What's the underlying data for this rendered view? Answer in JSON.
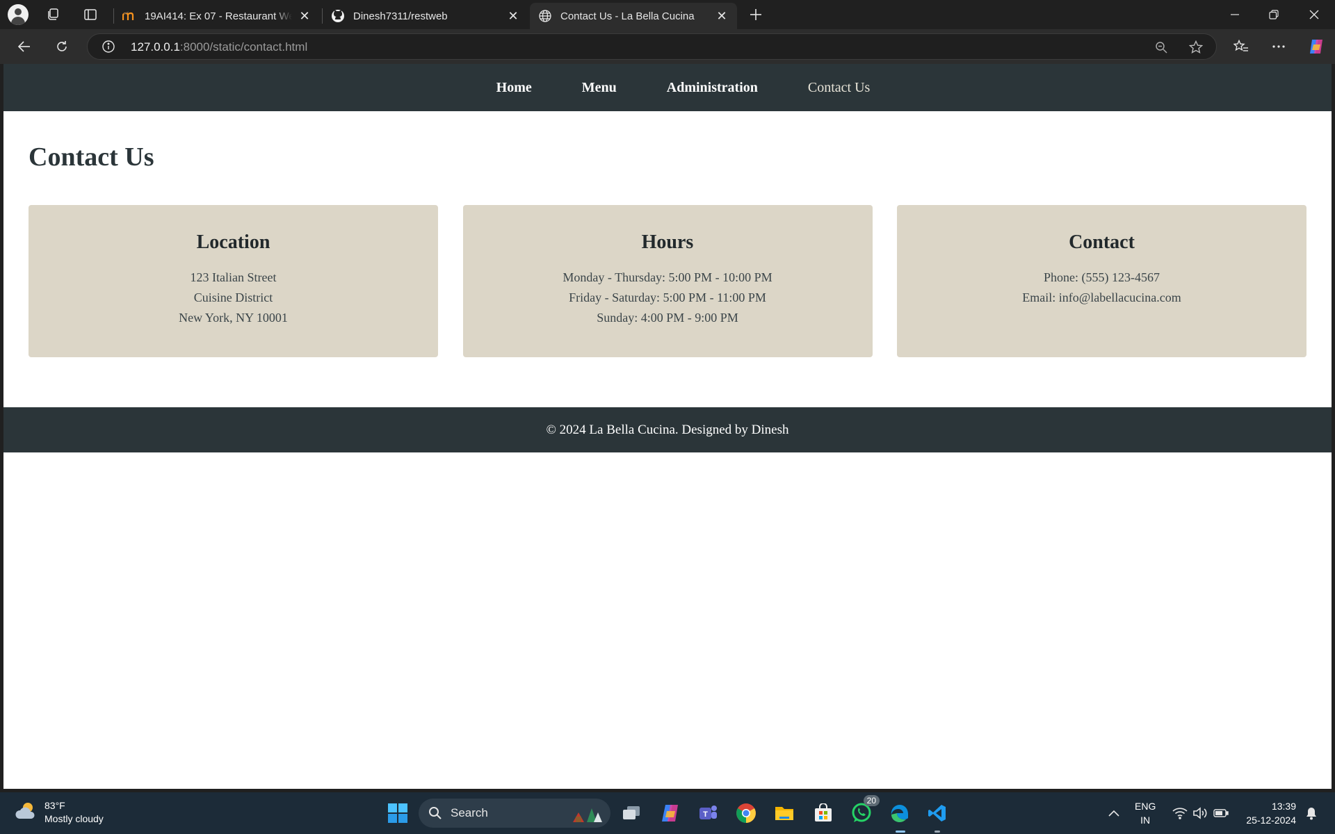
{
  "browser": {
    "tabs": [
      {
        "title": "19AI414: Ex 07 - Restaurant Webs",
        "favicon": "moodle-icon"
      },
      {
        "title": "Dinesh7311/restweb",
        "favicon": "github-icon"
      },
      {
        "title": "Contact Us - La Bella Cucina",
        "favicon": "globe-icon",
        "active": true
      }
    ],
    "url_host": "127.0.0.1",
    "url_rest": ":8000/static/contact.html"
  },
  "site": {
    "nav": [
      "Home",
      "Menu",
      "Administration",
      "Contact Us"
    ],
    "page_title": "Contact Us",
    "cards": [
      {
        "heading": "Location",
        "lines": [
          "123 Italian Street",
          "Cuisine District",
          "New York, NY 10001"
        ]
      },
      {
        "heading": "Hours",
        "lines": [
          "Monday - Thursday: 5:00 PM - 10:00 PM",
          "Friday - Saturday: 5:00 PM - 11:00 PM",
          "Sunday: 4:00 PM - 9:00 PM"
        ]
      },
      {
        "heading": "Contact",
        "lines": [
          "Phone: (555) 123-4567",
          "Email: info@labellacucina.com"
        ]
      }
    ],
    "footer": "© 2024 La Bella Cucina. Designed by Dinesh"
  },
  "taskbar": {
    "weather_temp": "83°F",
    "weather_desc": "Mostly cloudy",
    "search_label": "Search",
    "whatsapp_badge": "20",
    "lang_top": "ENG",
    "lang_bottom": "IN",
    "time": "13:39",
    "date": "25-12-2024"
  },
  "colors": {
    "nav_bg": "#2b3539",
    "card_bg": "#dcd6c7",
    "title": "#2b3539"
  }
}
